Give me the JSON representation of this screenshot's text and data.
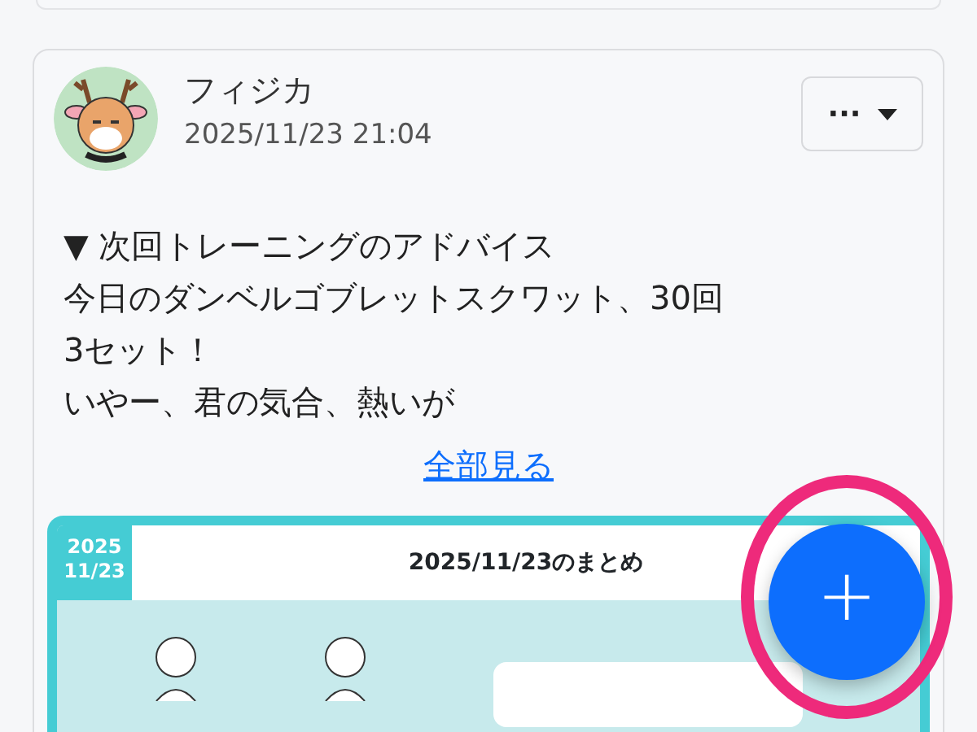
{
  "post": {
    "author": "フィジカ",
    "timestamp": "2025/11/23 21:04",
    "menu_button": {
      "label": "···"
    },
    "body_lines": [
      "▼ 次回トレーニングのアドバイス",
      "今日のダンベルゴブレットスクワット、30回",
      "3セット！",
      "いやー、君の気合、熱いが"
    ],
    "show_all_link": "全部見る",
    "summary_image": {
      "date_tab": [
        "2025",
        "11/23"
      ],
      "title": "2025/11/23のまとめ"
    }
  },
  "fab": {
    "label": "+",
    "highlighted": true
  }
}
